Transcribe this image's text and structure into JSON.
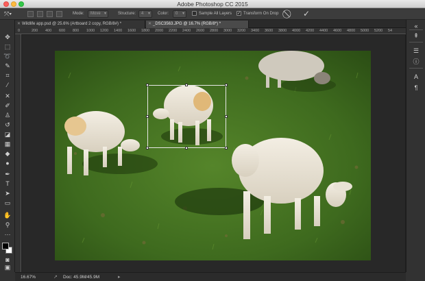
{
  "window": {
    "title": "Adobe Photoshop CC 2015"
  },
  "options_bar": {
    "mode_label": "Mode:",
    "mode_value": "Move",
    "structure_label": "Structure:",
    "structure_value": "4",
    "color_label": "Color:",
    "color_value": "0",
    "sample_all_layers": "Sample All Layers",
    "sample_all_layers_checked": false,
    "transform_on_drop": "Transform On Drop",
    "transform_on_drop_checked": true,
    "cancel_icon": "cancel-icon",
    "commit_icon": "checkmark-icon"
  },
  "tabs": [
    {
      "label": "Wildlife app.psd @ 25.6% (Artboard 2 copy, RGB/8#) *",
      "active": false
    },
    {
      "label": "_DSC3563.JPG @ 16.7% (RGB/8*) *",
      "active": true
    }
  ],
  "ruler": {
    "ticks": [
      "0",
      "200",
      "400",
      "600",
      "800",
      "1000",
      "1200",
      "1400",
      "1600",
      "1800",
      "2000",
      "2200",
      "2400",
      "2600",
      "2800",
      "3000",
      "3200",
      "3400",
      "3600",
      "3800",
      "4000",
      "4200",
      "4400",
      "4600",
      "4800",
      "5000",
      "5200",
      "54"
    ]
  },
  "status": {
    "zoom": "16.67%",
    "doc": "Doc: 45.9M/45.9M"
  },
  "colors": {
    "foreground": "#000000",
    "background": "#ffffff",
    "ui_dark": "#323232",
    "grass": "#3f6a1d"
  }
}
